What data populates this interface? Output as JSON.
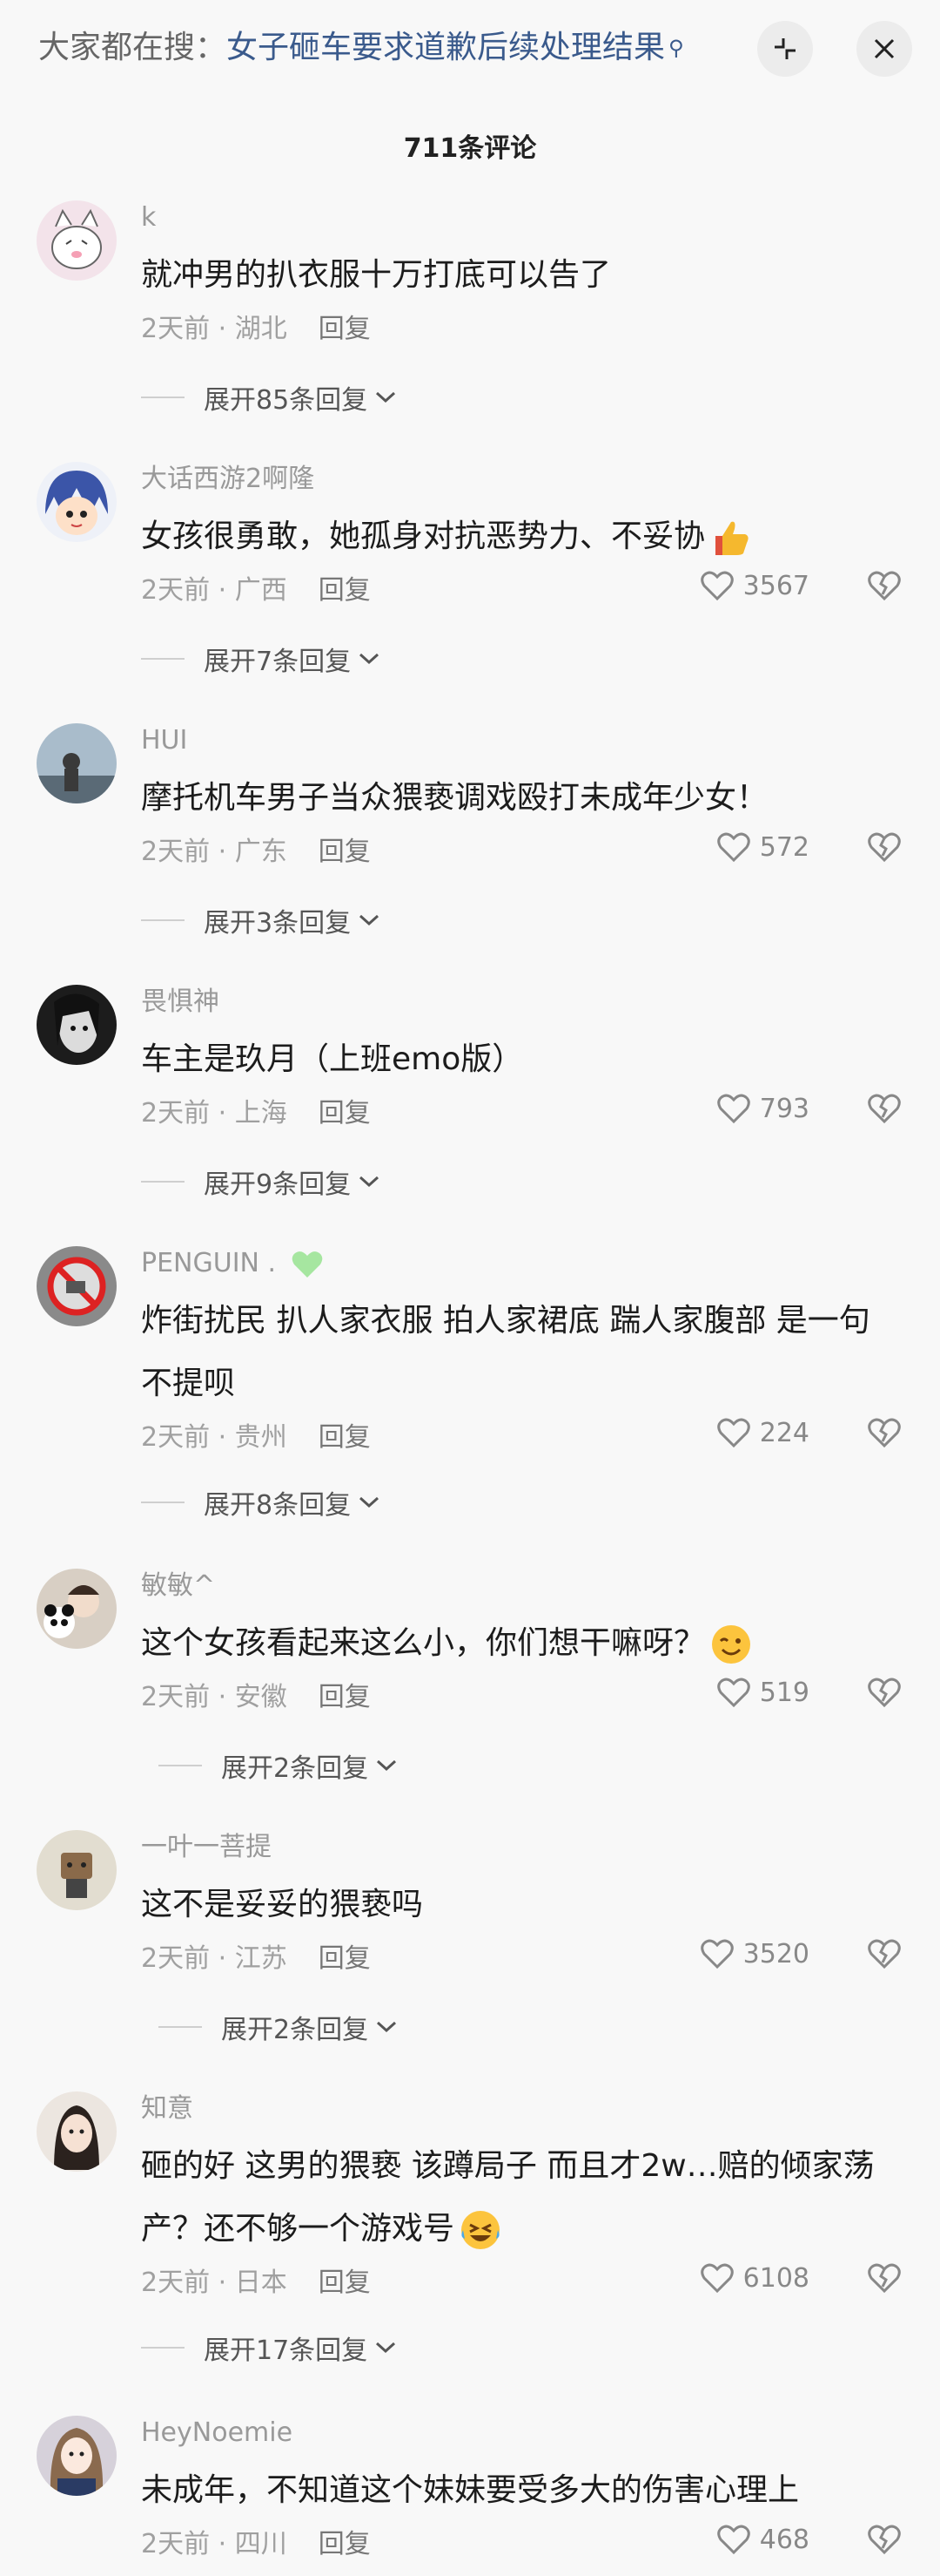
{
  "search": {
    "prefix": "大家都在搜：",
    "query": "女子砸车要求道歉后续处理结果"
  },
  "header": {
    "comment_count": "711条评论"
  },
  "comments": [
    {
      "username": "k",
      "text": "就冲男的扒衣服十万打底可以告了",
      "time_location": "2天前 · 湖北",
      "reply_label": "回复",
      "likes": "",
      "expand": "展开85条回复",
      "avatar_color": "#f3e3ea"
    },
    {
      "username": "大话西游2啊隆",
      "text": "女孩很勇敢，她孤身对抗恶势力、不妥协",
      "time_location": "2天前 · 广西",
      "reply_label": "回复",
      "likes": "3567",
      "expand": "展开7条回复",
      "avatar_color": "#3b55a8"
    },
    {
      "username": "HUI",
      "text": "摩托机车男子当众猥亵调戏殴打未成年少女！",
      "time_location": "2天前 · 广东",
      "reply_label": "回复",
      "likes": "572",
      "expand": "展开3条回复",
      "avatar_color": "#8fa4b4"
    },
    {
      "username": "畏惧神",
      "text": "车主是玖月（上班emo版）",
      "time_location": "2天前 · 上海",
      "reply_label": "回复",
      "likes": "793",
      "expand": "展开9条回复",
      "avatar_color": "#2a2a2a"
    },
    {
      "username": "PENGUIN .",
      "text": "炸街扰民 扒人家衣服 拍人家裙底 踹人家腹部 是一句不提呗",
      "time_location": "2天前 · 贵州",
      "reply_label": "回复",
      "likes": "224",
      "expand": "展开8条回复",
      "avatar_color": "#8a8a8a"
    },
    {
      "username": "敏敏^",
      "text": "这个女孩看起来这么小，你们想干嘛呀？",
      "time_location": "2天前 · 安徽",
      "reply_label": "回复",
      "likes": "519",
      "expand": "展开2条回复",
      "avatar_color": "#d8cfc4"
    },
    {
      "username": "一叶一菩提",
      "text": "这不是妥妥的猥亵吗",
      "time_location": "2天前 · 江苏",
      "reply_label": "回复",
      "likes": "3520",
      "expand": "展开2条回复",
      "avatar_color": "#dcd6c6"
    },
    {
      "username": "知意",
      "text": "砸的好 这男的猥亵 该蹲局子 而且才2w…赔的倾家荡产？还不够一个游戏号",
      "time_location": "2天前 · 日本",
      "reply_label": "回复",
      "likes": "6108",
      "expand": "展开17条回复",
      "avatar_color": "#e7ddd6"
    },
    {
      "username": "HeyNoemie",
      "text": "未成年，不知道这个妹妹要受多大的伤害心理上",
      "time_location": "2天前 · 四川",
      "reply_label": "回复",
      "likes": "468",
      "expand": "",
      "avatar_color": "#c9c3cf"
    }
  ]
}
